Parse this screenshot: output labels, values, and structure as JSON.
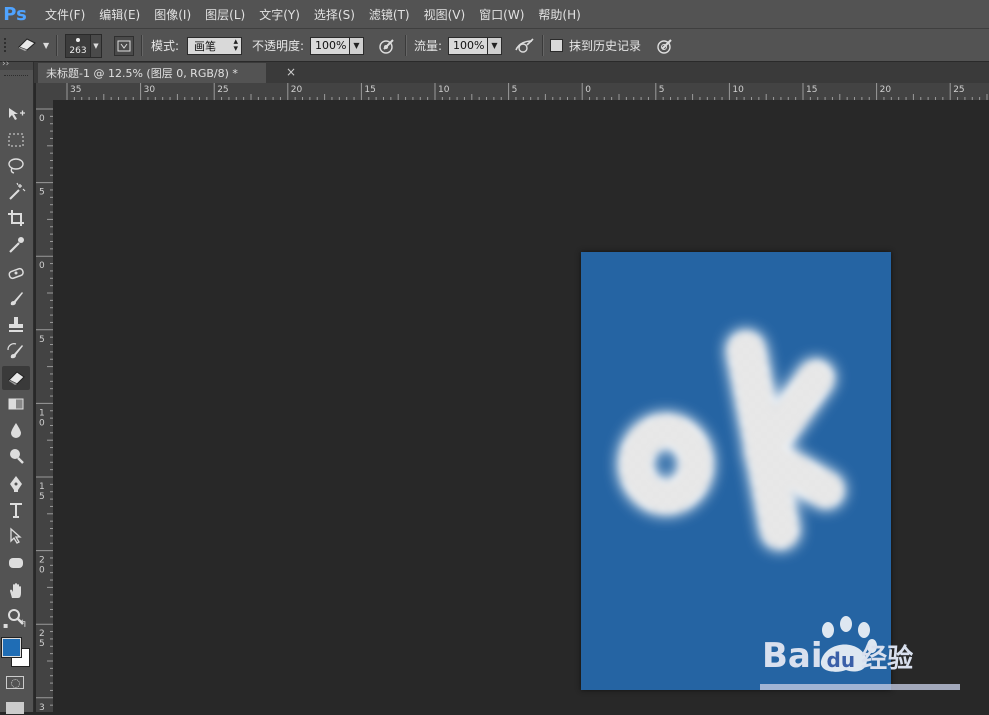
{
  "app": {
    "logo": "Ps"
  },
  "menu": [
    "文件(F)",
    "编辑(E)",
    "图像(I)",
    "图层(L)",
    "文字(Y)",
    "选择(S)",
    "滤镜(T)",
    "视图(V)",
    "窗口(W)",
    "帮助(H)"
  ],
  "options": {
    "brush_size": "263",
    "mode_label": "模式:",
    "mode_value": "画笔",
    "opacity_label": "不透明度:",
    "opacity_value": "100%",
    "flow_label": "流量:",
    "flow_value": "100%",
    "erase_history_label": "抹到历史记录"
  },
  "document": {
    "tab_title": "未标题-1 @ 12.5% (图层 0, RGB/8) *",
    "close_glyph": "×",
    "bg_color": "#2564a3",
    "text": "oK"
  },
  "rulers": {
    "horizontal_labels": [
      "35",
      "30",
      "25",
      "20",
      "15",
      "10",
      "5",
      "0",
      "5",
      "10",
      "15",
      "20",
      "25"
    ],
    "vertical_labels": [
      "0",
      "5",
      "0",
      "5",
      "1 0",
      "1 5",
      "2 0",
      "2 5",
      "3"
    ]
  },
  "colors": {
    "foreground": "#1f6db5",
    "background": "#ffffff",
    "accent": "#4fa3ff"
  },
  "watermark": {
    "brand": "Bai",
    "brand2": "du",
    "suffix": "经验"
  },
  "tools": [
    "move-icon",
    "marquee-icon",
    "lasso-icon",
    "magic-wand-icon",
    "crop-icon",
    "eyedropper-icon",
    "healing-icon",
    "brush-icon",
    "stamp-icon",
    "history-brush-icon",
    "eraser-icon",
    "gradient-icon",
    "blur-icon",
    "dodge-icon",
    "pen-icon",
    "type-icon",
    "path-select-icon",
    "shape-icon",
    "hand-icon",
    "zoom-icon"
  ]
}
